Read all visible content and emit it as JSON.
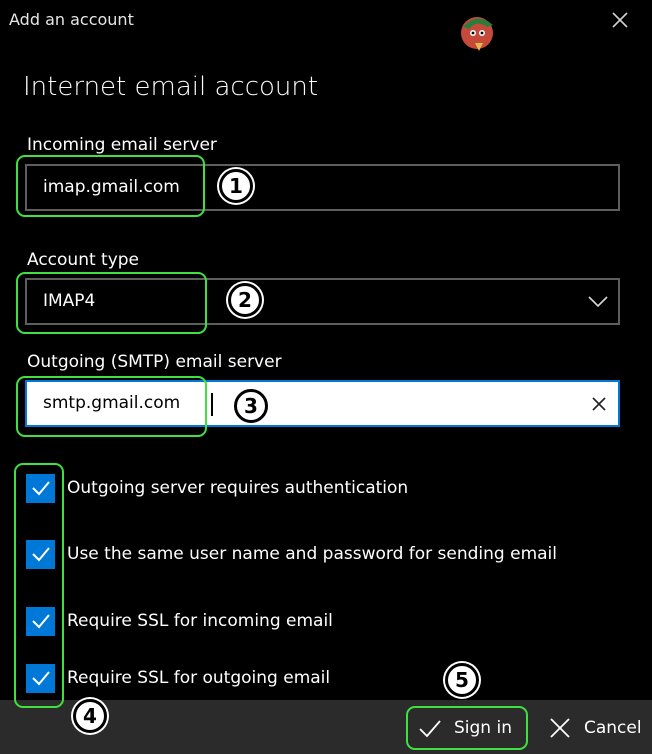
{
  "window": {
    "title": "Add an account"
  },
  "heading": "Internet email account",
  "incoming": {
    "label": "Incoming email server",
    "value": "imap.gmail.com"
  },
  "account_type": {
    "label": "Account type",
    "value": "IMAP4"
  },
  "outgoing": {
    "label": "Outgoing (SMTP) email server",
    "value": "smtp.gmail.com"
  },
  "options": [
    {
      "label": "Outgoing server requires authentication",
      "checked": true
    },
    {
      "label": "Use the same user name and password for sending email",
      "checked": true
    },
    {
      "label": "Require SSL for incoming email",
      "checked": true
    },
    {
      "label": "Require SSL for outgoing email",
      "checked": true
    }
  ],
  "annotations": [
    "1",
    "2",
    "3",
    "4",
    "5"
  ],
  "buttons": {
    "sign_in": "Sign in",
    "cancel": "Cancel"
  },
  "colors": {
    "accent": "#0078d7",
    "highlight": "#3fe03f",
    "footer": "#2b2b2b",
    "background": "#000000"
  }
}
